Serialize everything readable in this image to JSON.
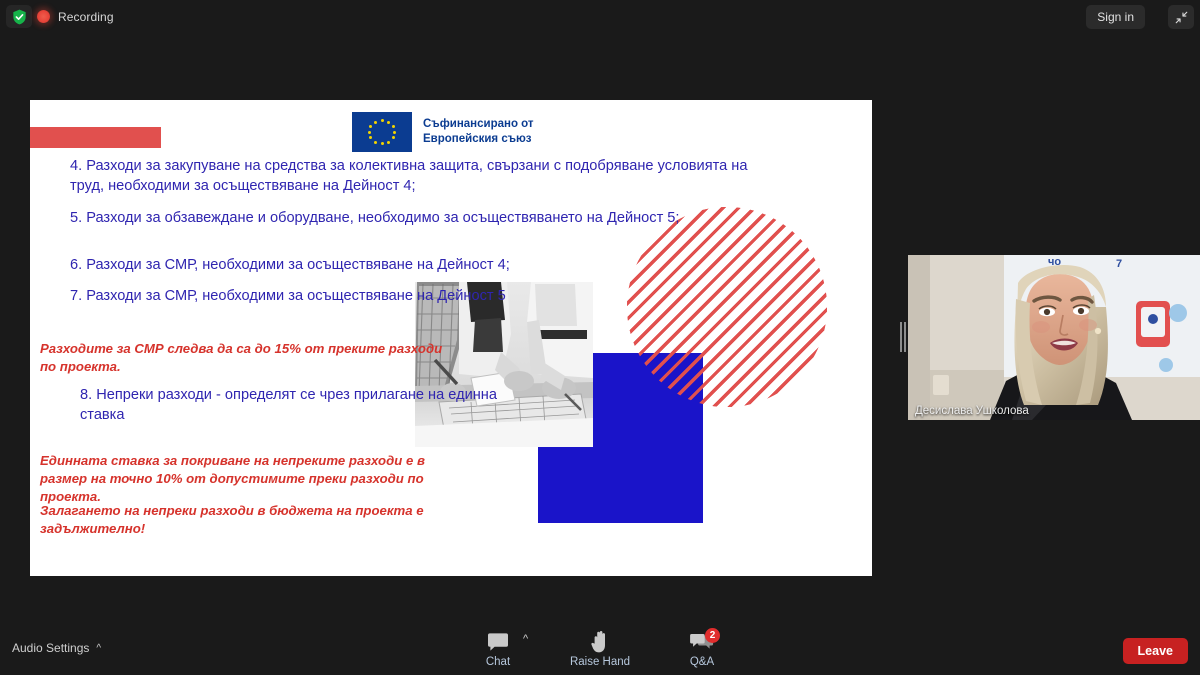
{
  "topbar": {
    "shield_icon": "shield-check-icon",
    "recording_label": "Recording",
    "signin_label": "Sign in",
    "minimize_icon": "exit-fullscreen-icon"
  },
  "slide": {
    "eu_logo": {
      "icon": "eu-flag-icon",
      "text": "Съфинансирано от\nЕвропейския съюз"
    },
    "bullets": [
      "4. Разходи за закупуване на средства за колективна защита, свързани с подобряване условията на труд, необходими за осъществяване на Дейност 4;",
      "5. Разходи за обзавеждане и оборудване, необходимо за осъществяването на Дейност 5;",
      "6. Разходи за СМР, необходими за осъществяване на Дейност 4;",
      "7. Разходи за СМР, необходими за осъществяване на Дейност 5",
      "8. Непреки разходи - определят се чрез прилагане на единна ставка"
    ],
    "notes": [
      "Разходите за СМР следва да са до 15% от преките разходи по проекта.",
      "Единната ставка за покриване на непреките разходи е в размер на точно 10% от допустимите преки разходи по проекта.",
      "Залагането на непреки разходи в бюджета на проекта е задължително!"
    ],
    "colors": {
      "text_blue": "#2f25b0",
      "note_red": "#d6332c",
      "accent_red": "#e1504e",
      "accent_blue": "#1a14c9",
      "eu_blue": "#0b3c91"
    },
    "decorations": {
      "red_bar": "red-bar-shape",
      "striped_circle": "striped-circle-shape",
      "blue_square": "blue-square-shape",
      "photo": "construction-plans-photo"
    }
  },
  "video": {
    "participant_name": "Десислава Ушколова",
    "drag_handle": "video-resize-handle"
  },
  "bottombar": {
    "audio_settings_label": "Audio Settings",
    "audio_caret_icon": "chevron-up-icon",
    "controls": [
      {
        "label": "Chat",
        "icon": "chat-bubble-icon",
        "badge": ""
      },
      {
        "label": "Raise Hand",
        "icon": "raised-hand-icon",
        "badge": ""
      },
      {
        "label": "Q&A",
        "icon": "qa-bubbles-icon",
        "badge": "2"
      }
    ],
    "chat_caret_icon": "chevron-up-icon",
    "leave_label": "Leave",
    "leave_color": "#c72121"
  }
}
